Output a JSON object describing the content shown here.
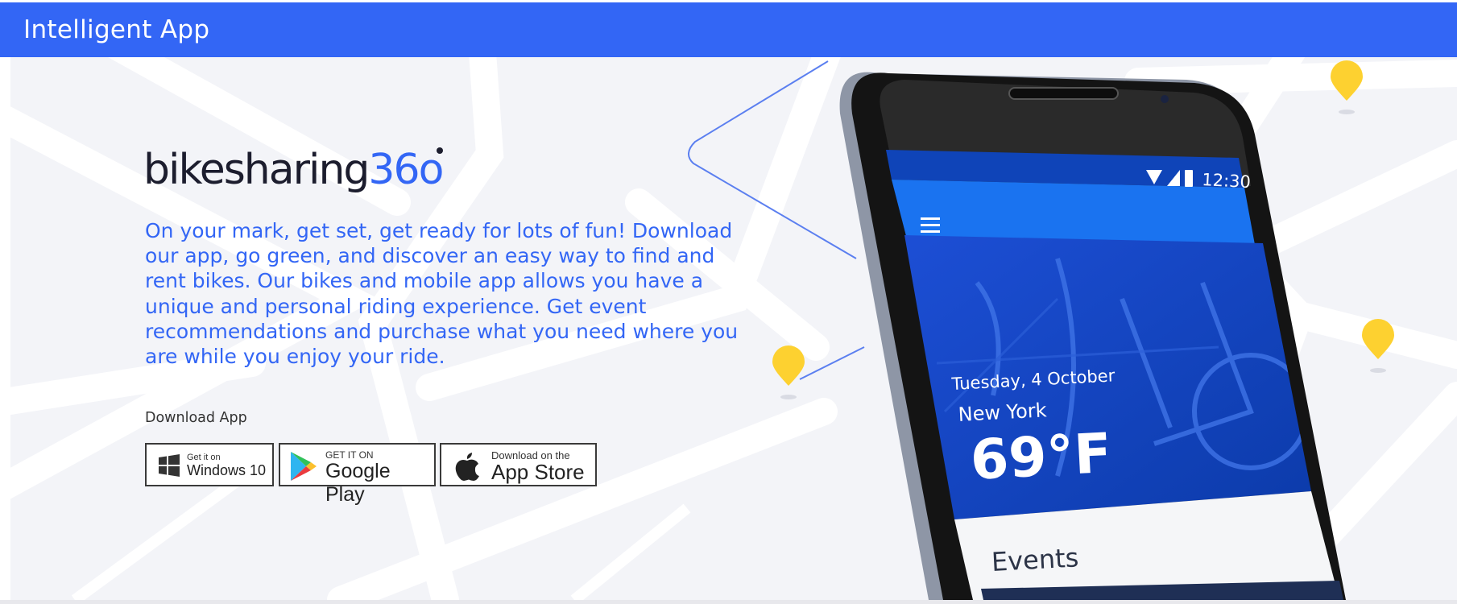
{
  "app": {
    "title": "Intelligent App"
  },
  "brand": {
    "logo_part1": "bikesharing",
    "logo_part2": "36o"
  },
  "hero": {
    "description": "On your mark, get set, get ready for lots of fun! Download our app, go green, and discover an easy way to find and rent bikes. Our bikes and mobile app allows you have a unique and personal riding experience. Get event recommendations and purchase what you need where you are while you enjoy your ride.",
    "download_label": "Download App"
  },
  "stores": {
    "windows": {
      "small": "Get it on",
      "big": "Windows 10",
      "icon": "windows-logo-icon"
    },
    "google": {
      "small": "GET IT ON",
      "big": "Google Play",
      "icon": "google-play-icon"
    },
    "apple": {
      "small": "Download on the",
      "big": "App Store",
      "icon": "apple-logo-icon"
    }
  },
  "phone": {
    "status_time": "12:30",
    "date": "Tuesday, 4 October",
    "city": "New York",
    "temperature": "69°F",
    "section_title": "Events"
  },
  "colors": {
    "topbar": "#3366f5",
    "accent": "#3366f5",
    "pin": "#fdd130",
    "background": "#f3f4f8"
  }
}
